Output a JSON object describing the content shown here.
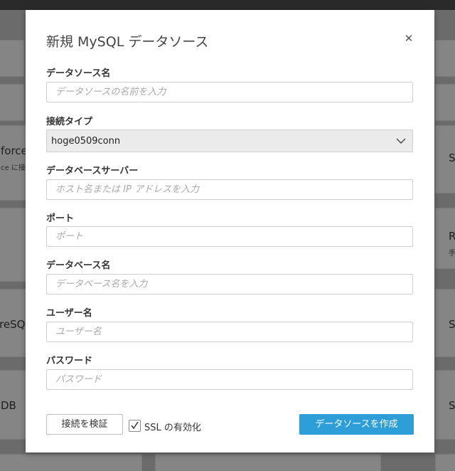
{
  "background": {
    "cards": [
      {
        "title": "force",
        "subtitle": "ce に接"
      },
      {
        "title": "reSQ",
        "subtitle": ""
      },
      {
        "title": "DB",
        "subtitle": ""
      },
      {
        "title": "S",
        "subtitle": ""
      },
      {
        "title": "R",
        "subtitle": "手"
      },
      {
        "title": "S",
        "subtitle": ""
      },
      {
        "title": "S",
        "subtitle": ""
      }
    ]
  },
  "modal": {
    "title": "新規 MySQL データソース",
    "close_icon": "close-icon",
    "fields": {
      "datasource_name": {
        "label": "データソース名",
        "placeholder": "データソースの名前を入力",
        "value": ""
      },
      "connection_type": {
        "label": "接続タイプ",
        "value": "hoge0509conn",
        "icon": "chevron-down-icon"
      },
      "database_server": {
        "label": "データベースサーバー",
        "placeholder": "ホスト名または IP アドレスを入力",
        "value": ""
      },
      "port": {
        "label": "ポート",
        "placeholder": "ポート",
        "value": ""
      },
      "database_name": {
        "label": "データベース名",
        "placeholder": "データベース名を入力",
        "value": ""
      },
      "username": {
        "label": "ユーザー名",
        "placeholder": "ユーザー名",
        "value": ""
      },
      "password": {
        "label": "パスワード",
        "placeholder": "パスワード",
        "value": ""
      }
    },
    "footer": {
      "verify_label": "接続を検証",
      "ssl_label": "SSL の有効化",
      "ssl_checked": true,
      "create_label": "データソースを作成"
    },
    "colors": {
      "primary": "#2d9ed8",
      "overlay": "#6b6b6b"
    }
  }
}
